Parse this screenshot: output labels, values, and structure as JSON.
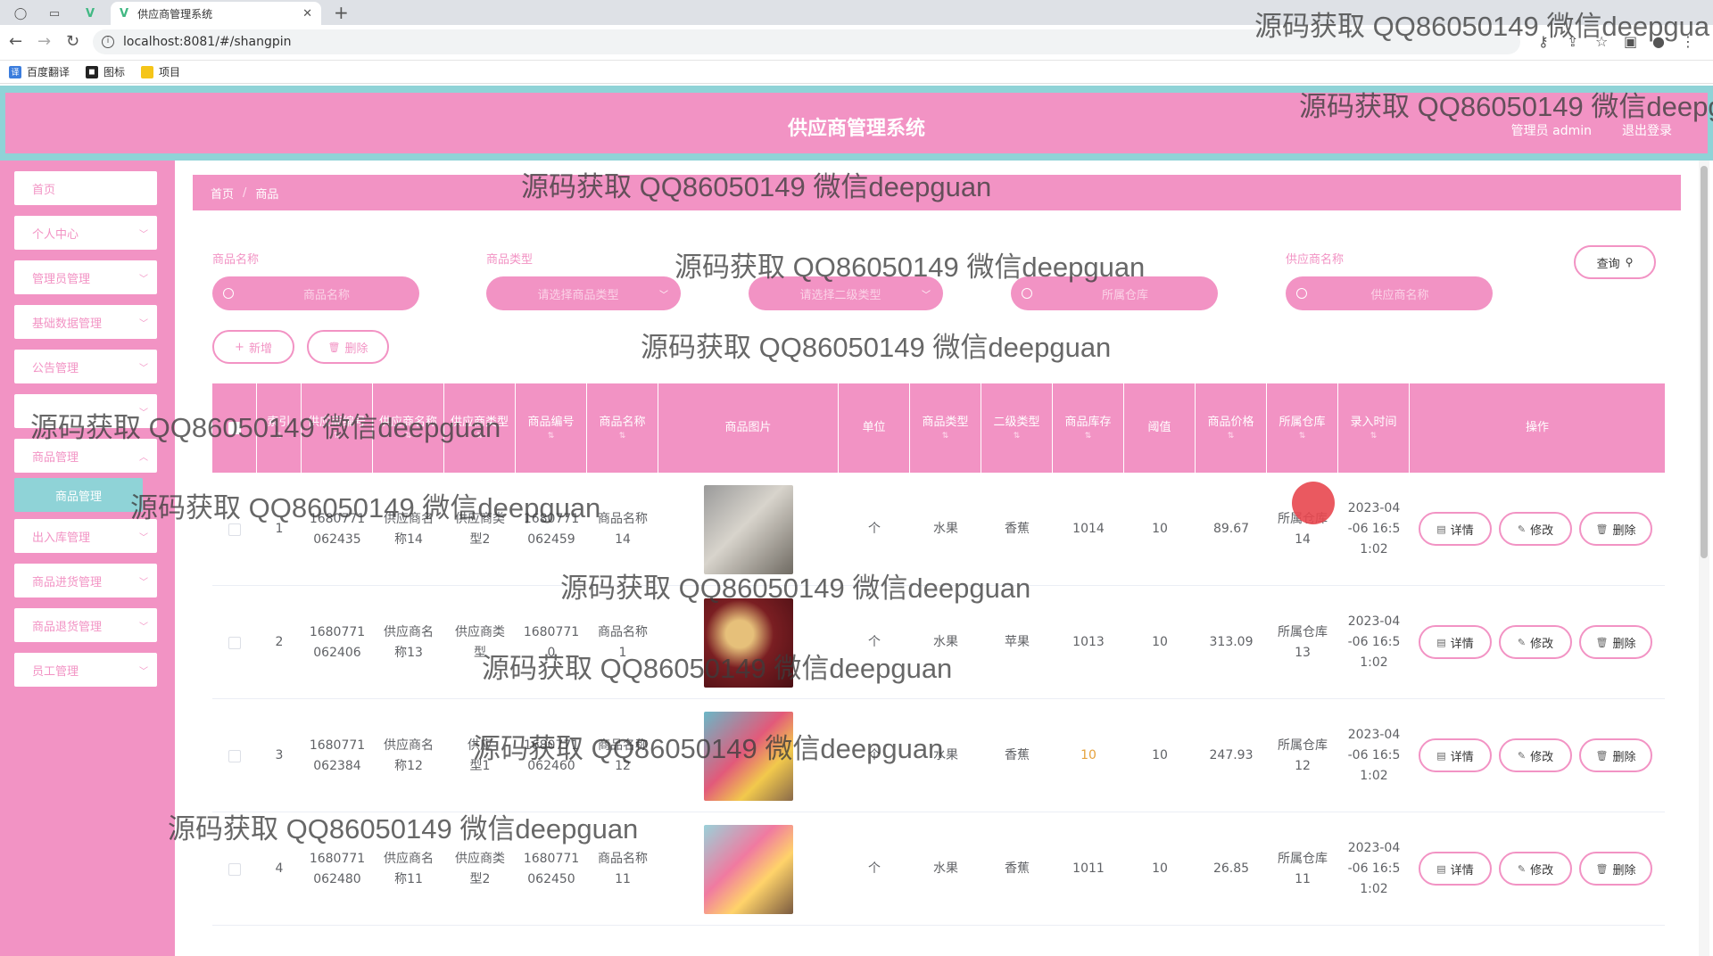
{
  "browser": {
    "tab_title": "供应商管理系统",
    "url": "localhost:8081/#/shangpin",
    "bookmarks": [
      "百度翻译",
      "图标",
      "项目"
    ]
  },
  "app": {
    "title": "供应商管理系统",
    "user": "管理员 admin",
    "logout": "退出登录"
  },
  "sidebar": {
    "items": [
      "首页",
      "个人中心",
      "管理员管理",
      "基础数据管理",
      "公告管理",
      "",
      "商品管理",
      "出入库管理",
      "商品进货管理",
      "商品退货管理",
      "员工管理"
    ],
    "active_sub": "商品管理"
  },
  "breadcrumb": {
    "home": "首页",
    "current": "商品"
  },
  "filters": {
    "name_label": "商品名称",
    "name_placeholder": "商品名称",
    "type_label": "商品类型",
    "type_placeholder": "请选择商品类型",
    "subtype_placeholder": "请选择二级类型",
    "warehouse_placeholder": "所属仓库",
    "supplier_label": "供应商名称",
    "supplier_placeholder": "供应商名称",
    "query_button": "查询"
  },
  "actions": {
    "add": "新增",
    "delete": "删除"
  },
  "table": {
    "headers": [
      "索引",
      "供应商编号",
      "供应商名称",
      "供应商类型",
      "商品编号",
      "商品名称",
      "商品图片",
      "单位",
      "商品类型",
      "二级类型",
      "商品库存",
      "阈值",
      "商品价格",
      "所属仓库",
      "录入时间",
      "操作"
    ],
    "header_top_fragment": "供应商编",
    "rows": [
      {
        "index": "1",
        "supplier_no": "1680771\n062435",
        "supplier_name": "供应商名\n称14",
        "supplier_type": "供应商类\n型2",
        "product_no": "1680771\n062459",
        "product_name": "商品名称\n14",
        "unit": "个",
        "type": "水果",
        "subtype": "香蕉",
        "stock": "1014",
        "threshold": "10",
        "price": "89.67",
        "warehouse": "所属仓库\n14",
        "time": "2023-04\n-06 16:5\n1:02"
      },
      {
        "index": "2",
        "supplier_no": "1680771\n062406",
        "supplier_name": "供应商名\n称13",
        "supplier_type": "供应商类\n型",
        "product_no": "1680771\n0",
        "product_name": "商品名称\n1",
        "unit": "个",
        "type": "水果",
        "subtype": "苹果",
        "stock": "1013",
        "threshold": "10",
        "price": "313.09",
        "warehouse": "所属仓库\n13",
        "time": "2023-04\n-06 16:5\n1:02"
      },
      {
        "index": "3",
        "supplier_no": "1680771\n062384",
        "supplier_name": "供应商名\n称12",
        "supplier_type": "供应\n型1",
        "product_no": "1680771\n062460",
        "product_name": "商品名称\n12",
        "unit": "个",
        "type": "水果",
        "subtype": "香蕉",
        "stock": "10",
        "threshold": "10",
        "price": "247.93",
        "warehouse": "所属仓库\n12",
        "time": "2023-04\n-06 16:5\n1:02"
      },
      {
        "index": "4",
        "supplier_no": "1680771\n062480",
        "supplier_name": "供应商名\n称11",
        "supplier_type": "供应商类\n型2",
        "product_no": "1680771\n062450",
        "product_name": "商品名称\n11",
        "unit": "个",
        "type": "水果",
        "subtype": "香蕉",
        "stock": "1011",
        "threshold": "10",
        "price": "26.85",
        "warehouse": "所属仓库\n11",
        "time": "2023-04\n-06 16:5\n1:02"
      }
    ],
    "row_buttons": {
      "detail": "详情",
      "edit": "修改",
      "delete": "删除"
    }
  },
  "watermark": {
    "top_right": "源码获取 QQ86050149 微信deepgua",
    "header": "源码获取 QQ86050149 微信deepguan",
    "text": "源码获取 QQ86050149 微信deepguan"
  },
  "colors": {
    "pink": "#f293c4",
    "teal": "#8fd3d7",
    "warning": "#e6a23c"
  }
}
